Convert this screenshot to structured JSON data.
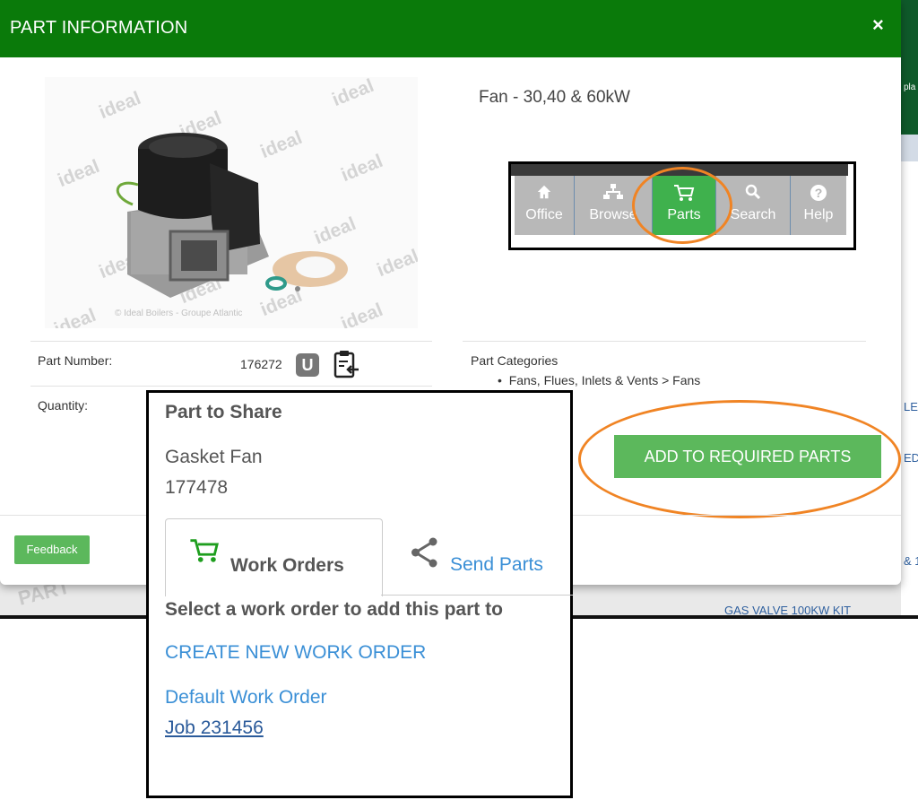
{
  "modal": {
    "title": "PART INFORMATION",
    "close_glyph": "×",
    "part_name": "Fan - 30,40 & 60kW",
    "photo": {
      "watermark": "ideal",
      "copyright": "© Ideal Boilers - Groupe Atlantic"
    },
    "nav": {
      "items": [
        {
          "label": "Office",
          "icon": "home-icon"
        },
        {
          "label": "Browse",
          "icon": "sitemap-icon"
        },
        {
          "label": "Parts",
          "icon": "cart-icon"
        },
        {
          "label": "Search",
          "icon": "search-icon"
        },
        {
          "label": "Help",
          "icon": "help-icon"
        }
      ]
    },
    "part_number_label": "Part Number:",
    "part_number": "176272",
    "u_badge": "U",
    "quantity_label": "Quantity:",
    "categories_title": "Part Categories",
    "category_item": "Fans, Flues, Inlets & Vents > Fans",
    "add_button": "ADD TO REQUIRED PARTS",
    "feedback_button": "Feedback"
  },
  "background": {
    "partial_texts": [
      "pla",
      "LE",
      "ED",
      "& 1",
      "GAS VALVE 100KW KIT"
    ]
  },
  "share": {
    "title": "Part to Share",
    "part_name": "Gasket Fan",
    "part_number": "177478",
    "tabs": [
      {
        "label": "Work Orders",
        "icon": "cart-icon"
      },
      {
        "label": "Send Parts",
        "icon": "share-icon"
      }
    ],
    "instruction": "Select a work order to add this part to",
    "create_link": "CREATE NEW WORK ORDER",
    "work_orders": [
      "Default Work Order",
      "Job 231456"
    ]
  },
  "colors": {
    "header_green": "#0a7a0a",
    "button_green": "#5cb85c",
    "highlight_orange": "#f08424",
    "link_blue": "#3a8fd6"
  }
}
